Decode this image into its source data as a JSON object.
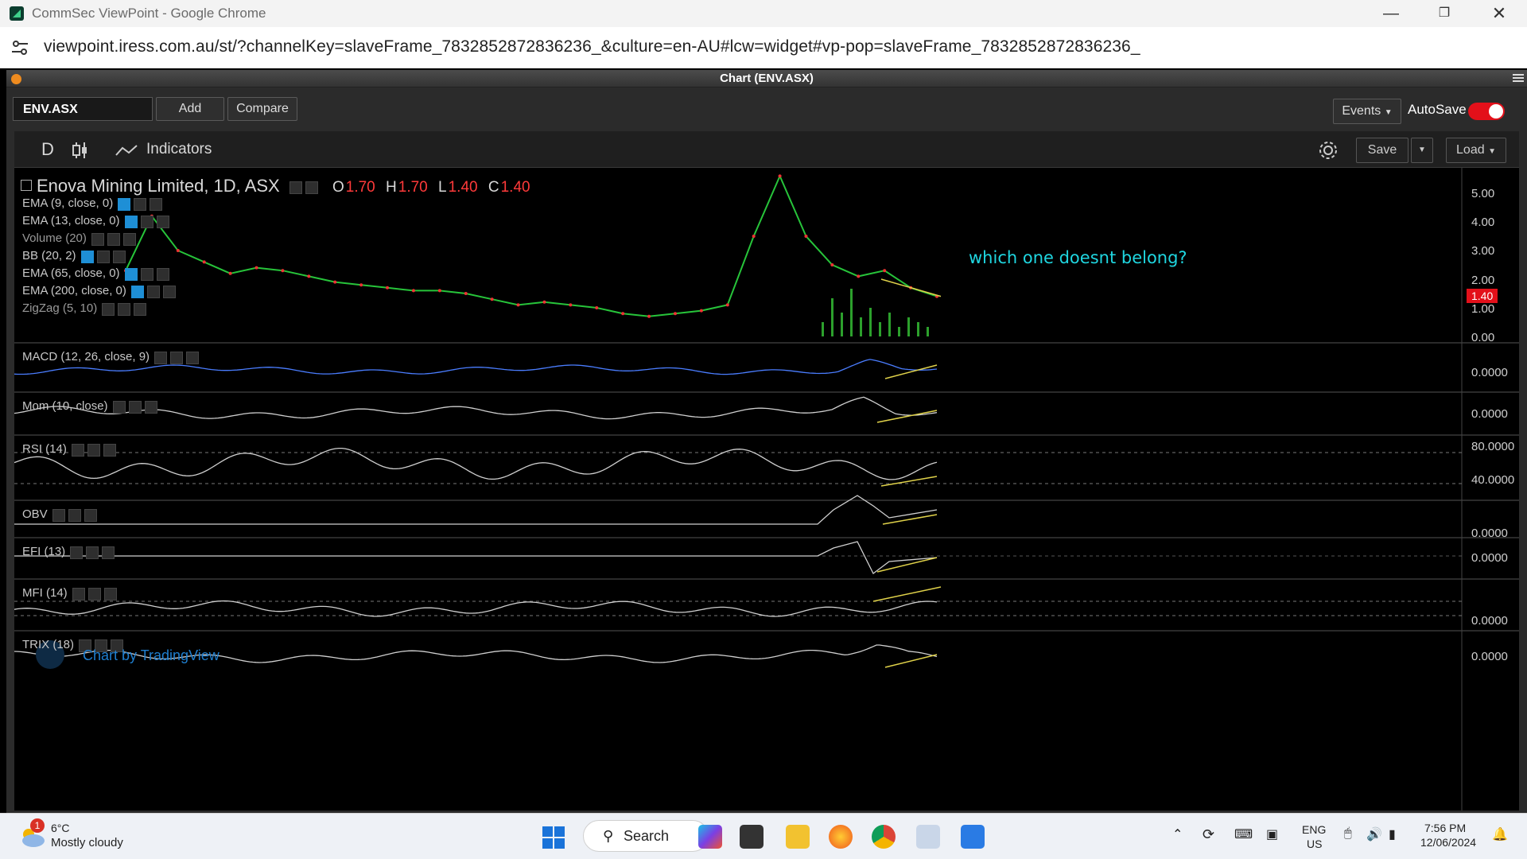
{
  "browser": {
    "window_title": "CommSec ViewPoint - Google Chrome",
    "url": "viewpoint.iress.com.au/st/?channelKey=slaveFrame_7832852872836236_&culture=en-AU#lcw=widget#vp-pop=slaveFrame_7832852872836236_"
  },
  "widget": {
    "title": "Chart (ENV.ASX)",
    "symbol_value": "ENV.ASX",
    "add_label": "Add",
    "compare_label": "Compare",
    "events_label": "Events",
    "autosave_label": "AutoSave",
    "autosave_on": true
  },
  "toolbar": {
    "interval": "D",
    "indicators_label": "Indicators",
    "save_label": "Save",
    "load_label": "Load"
  },
  "legend": {
    "title": "Enova Mining Limited, 1D, ASX",
    "o_label": "O",
    "o_value": "1.70",
    "h_label": "H",
    "h_value": "1.70",
    "l_label": "L",
    "l_value": "1.40",
    "c_label": "C",
    "c_value": "1.40",
    "studies": [
      "EMA (9, close, 0)",
      "EMA (13, close, 0)",
      "Volume (20)",
      "BB (20, 2)",
      "EMA (65, close, 0)",
      "EMA (200, close, 0)",
      "ZigZag (5, 10)"
    ]
  },
  "annotation": "which one doesnt belong?",
  "watermark": "Chart by TradingView",
  "price_axis": {
    "ticks": [
      "5.00",
      "4.00",
      "3.00",
      "2.00",
      "1.00",
      "0.00"
    ],
    "last_price": "1.40"
  },
  "panes": [
    {
      "label": "MACD (12, 26, close, 9)",
      "axis": [
        "0.0000"
      ]
    },
    {
      "label": "Mom (10, close)",
      "axis": [
        "0.0000"
      ]
    },
    {
      "label": "RSI (14)",
      "axis": [
        "80.0000",
        "40.0000"
      ]
    },
    {
      "label": "OBV",
      "axis": [
        "0.0000"
      ]
    },
    {
      "label": "EFI (13)",
      "axis": [
        "0.0000"
      ]
    },
    {
      "label": "MFI (14)",
      "axis": [
        "0.0000"
      ]
    },
    {
      "label": "TRIX (18)",
      "axis": [
        "0.0000"
      ]
    }
  ],
  "chart_data": {
    "type": "line",
    "title": "Enova Mining Limited, 1D, ASX",
    "ylim": [
      0,
      5.5
    ],
    "y_ticks": [
      0,
      1,
      2,
      3,
      4,
      5
    ],
    "last": 1.4,
    "series": [
      {
        "name": "",
        "values": [
          2.3,
          4.2,
          3.0,
          2.6,
          2.2,
          2.4,
          2.3,
          2.1,
          1.9,
          1.8,
          1.7,
          1.6,
          1.6,
          1.5,
          1.3,
          1.1,
          1.2,
          1.1,
          1.0,
          0.8,
          0.7,
          0.8,
          0.9,
          1.1,
          3.5,
          5.6,
          3.5,
          2.5,
          2.1,
          2.3,
          1.7,
          1.4
        ]
      }
    ]
  },
  "taskbar": {
    "weather_temp": "6°C",
    "weather_desc": "Mostly cloudy",
    "weather_badge": "1",
    "search_label": "Search",
    "lang_top": "ENG",
    "lang_bottom": "US",
    "time": "7:56 PM",
    "date": "12/06/2024"
  }
}
